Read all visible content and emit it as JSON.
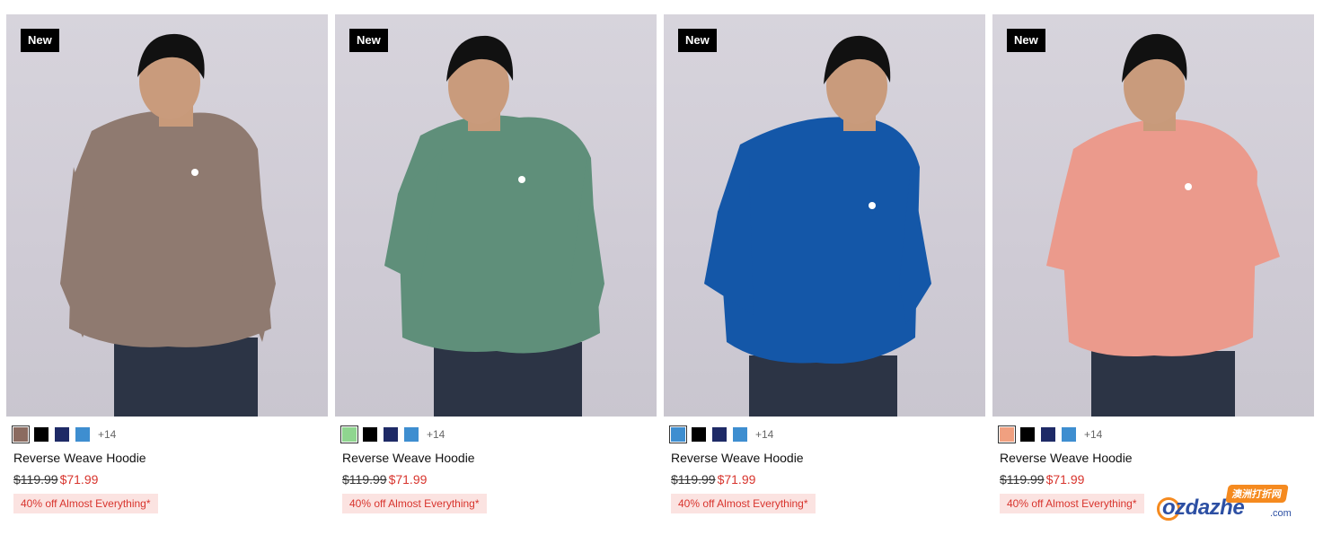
{
  "products": [
    {
      "badge": "New",
      "title": "Reverse Weave Hoodie",
      "was_price": "$119.99",
      "now_price": "$71.99",
      "promo": "40% off Almost Everything*",
      "more_colors": "+14",
      "hoodie_color": "#8f7a70",
      "swatches": [
        "#8b6b60",
        "#000000",
        "#1e2a66",
        "#3e8ed0"
      ]
    },
    {
      "badge": "New",
      "title": "Reverse Weave Hoodie",
      "was_price": "$119.99",
      "now_price": "$71.99",
      "promo": "40% off Almost Everything*",
      "more_colors": "+14",
      "hoodie_color": "#5f8f7a",
      "swatches": [
        "#8fd58f",
        "#000000",
        "#1e2a66",
        "#3e8ed0"
      ]
    },
    {
      "badge": "New",
      "title": "Reverse Weave Hoodie",
      "was_price": "$119.99",
      "now_price": "$71.99",
      "promo": "40% off Almost Everything*",
      "more_colors": "+14",
      "hoodie_color": "#1457a8",
      "swatches": [
        "#3e8ed0",
        "#000000",
        "#1e2a66",
        "#3e8ed0"
      ]
    },
    {
      "badge": "New",
      "title": "Reverse Weave Hoodie",
      "was_price": "$119.99",
      "now_price": "$71.99",
      "promo": "40% off Almost Everything*",
      "more_colors": "+14",
      "hoodie_color": "#eb9a8c",
      "swatches": [
        "#f0a080",
        "#000000",
        "#1e2a66",
        "#3e8ed0"
      ]
    }
  ],
  "watermark": {
    "top": "澳洲打折网",
    "main": "ozdazhe",
    "suffix": ".com"
  },
  "colors": {
    "sale": "#d8352e",
    "promo_bg": "#fbe3e1"
  }
}
